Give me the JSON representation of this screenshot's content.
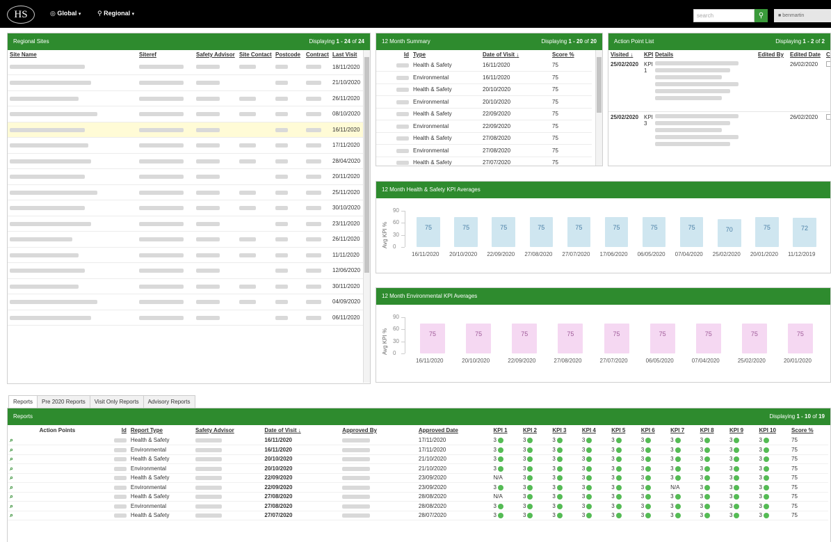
{
  "topbar": {
    "logo": "HS",
    "global_label": "Global",
    "regional_label": "Regional",
    "search_placeholder": "search",
    "user_label": "benmartin"
  },
  "regional_sites": {
    "title": "Regional Sites",
    "display_prefix": "Displaying",
    "display_range": "1 - 24",
    "display_of": "of",
    "display_total": "24",
    "columns": [
      "Site Name",
      "Siteref",
      "Safety Advisor",
      "Site Contact",
      "Postcode",
      "Contract",
      "Last Visit"
    ],
    "last_visits": [
      "18/11/2020",
      "21/10/2020",
      "26/11/2020",
      "08/10/2020",
      "16/11/2020",
      "17/11/2020",
      "28/04/2020",
      "20/11/2020",
      "25/11/2020",
      "30/10/2020",
      "23/11/2020",
      "26/11/2020",
      "11/11/2020",
      "12/06/2020",
      "30/11/2020",
      "04/09/2020",
      "06/11/2020"
    ]
  },
  "summary": {
    "title": "12 Month Summary",
    "display_prefix": "Displaying",
    "display_range": "1 - 20",
    "display_of": "of",
    "display_total": "20",
    "columns": {
      "id": "Id",
      "type": "Type",
      "date": "Date of Visit",
      "score": "Score %"
    },
    "rows": [
      {
        "type": "Health & Safety",
        "date": "16/11/2020",
        "score": "75"
      },
      {
        "type": "Environmental",
        "date": "16/11/2020",
        "score": "75"
      },
      {
        "type": "Health & Safety",
        "date": "20/10/2020",
        "score": "75"
      },
      {
        "type": "Environmental",
        "date": "20/10/2020",
        "score": "75"
      },
      {
        "type": "Health & Safety",
        "date": "22/09/2020",
        "score": "75"
      },
      {
        "type": "Environmental",
        "date": "22/09/2020",
        "score": "75"
      },
      {
        "type": "Health & Safety",
        "date": "27/08/2020",
        "score": "75"
      },
      {
        "type": "Environmental",
        "date": "27/08/2020",
        "score": "75"
      },
      {
        "type": "Health & Safety",
        "date": "27/07/2020",
        "score": "75"
      }
    ]
  },
  "action_points": {
    "title": "Action Point List",
    "display_prefix": "Displaying",
    "display_range": "1 - 2",
    "display_of": "of",
    "display_total": "2",
    "columns": {
      "visited": "Visited",
      "kpi": "KPI",
      "details": "Details",
      "edited_by": "Edited By",
      "edited_date": "Edited Date",
      "comp": "Comp"
    },
    "rows": [
      {
        "visited": "25/02/2020",
        "kpi": "KPI 1",
        "edited_date": "26/02/2020"
      },
      {
        "visited": "25/02/2020",
        "kpi": "KPI 3",
        "edited_date": "26/02/2020"
      }
    ]
  },
  "hs_chart": {
    "title": "12 Month Health & Safety KPI Averages"
  },
  "env_chart": {
    "title": "12 Month Environmental KPI Averages"
  },
  "chart_data": [
    {
      "type": "bar",
      "title": "12 Month Health & Safety KPI Averages",
      "ylabel": "Avg KPI %",
      "ylim": [
        0,
        90
      ],
      "yticks": [
        "90",
        "60",
        "30",
        "0"
      ],
      "categories": [
        "16/11/2020",
        "20/10/2020",
        "22/09/2020",
        "27/08/2020",
        "27/07/2020",
        "17/06/2020",
        "06/05/2020",
        "07/04/2020",
        "25/02/2020",
        "20/01/2020",
        "11/12/2019"
      ],
      "values": [
        75,
        75,
        75,
        75,
        75,
        75,
        75,
        75,
        70,
        75,
        72
      ],
      "color": "#cfe6f0"
    },
    {
      "type": "bar",
      "title": "12 Month Environmental KPI Averages",
      "ylabel": "Avg KPI %",
      "ylim": [
        0,
        90
      ],
      "yticks": [
        "90",
        "60",
        "30",
        "0"
      ],
      "categories": [
        "16/11/2020",
        "20/10/2020",
        "22/09/2020",
        "27/08/2020",
        "27/07/2020",
        "06/05/2020",
        "07/04/2020",
        "25/02/2020",
        "20/01/2020"
      ],
      "values": [
        75,
        75,
        75,
        75,
        75,
        75,
        75,
        75,
        75
      ],
      "color": "#f5d8f2"
    }
  ],
  "tabs": [
    "Reports",
    "Pre 2020 Reports",
    "Visit Only Reports",
    "Advisory Reports"
  ],
  "reports": {
    "title": "Reports",
    "display_prefix": "Displaying",
    "display_range": "1 - 10",
    "display_of": "of",
    "display_total": "19",
    "columns": [
      "Action Points",
      "Id",
      "Report Type",
      "Safety Advisor",
      "Date of Visit",
      "Approved By",
      "Approved Date",
      "KPI 1",
      "KPI 2",
      "KPI 3",
      "KPI 4",
      "KPI 5",
      "KPI 6",
      "KPI 7",
      "KPI 8",
      "KPI 9",
      "KPI 10",
      "Score %"
    ],
    "rows": [
      {
        "type": "Health & Safety",
        "date": "16/11/2020",
        "approved": "17/11/2020",
        "kpis": [
          "3",
          "3",
          "3",
          "3",
          "3",
          "3",
          "3",
          "3",
          "3",
          "3"
        ],
        "score": "75"
      },
      {
        "type": "Environmental",
        "date": "16/11/2020",
        "approved": "17/11/2020",
        "kpis": [
          "3",
          "3",
          "3",
          "3",
          "3",
          "3",
          "3",
          "3",
          "3",
          "3"
        ],
        "score": "75"
      },
      {
        "type": "Health & Safety",
        "date": "20/10/2020",
        "approved": "21/10/2020",
        "kpis": [
          "3",
          "3",
          "3",
          "3",
          "3",
          "3",
          "3",
          "3",
          "3",
          "3"
        ],
        "score": "75"
      },
      {
        "type": "Environmental",
        "date": "20/10/2020",
        "approved": "21/10/2020",
        "kpis": [
          "3",
          "3",
          "3",
          "3",
          "3",
          "3",
          "3",
          "3",
          "3",
          "3"
        ],
        "score": "75"
      },
      {
        "type": "Health & Safety",
        "date": "22/09/2020",
        "approved": "23/09/2020",
        "kpis": [
          "N/A",
          "3",
          "3",
          "3",
          "3",
          "3",
          "3",
          "3",
          "3",
          "3"
        ],
        "score": "75"
      },
      {
        "type": "Environmental",
        "date": "22/09/2020",
        "approved": "23/09/2020",
        "kpis": [
          "3",
          "3",
          "3",
          "3",
          "3",
          "3",
          "N/A",
          "3",
          "3",
          "3"
        ],
        "score": "75"
      },
      {
        "type": "Health & Safety",
        "date": "27/08/2020",
        "approved": "28/08/2020",
        "kpis": [
          "N/A",
          "3",
          "3",
          "3",
          "3",
          "3",
          "3",
          "3",
          "3",
          "3"
        ],
        "score": "75"
      },
      {
        "type": "Environmental",
        "date": "27/08/2020",
        "approved": "28/08/2020",
        "kpis": [
          "3",
          "3",
          "3",
          "3",
          "3",
          "3",
          "3",
          "3",
          "3",
          "3"
        ],
        "score": "75"
      },
      {
        "type": "Health & Safety",
        "date": "27/07/2020",
        "approved": "28/07/2020",
        "kpis": [
          "3",
          "3",
          "3",
          "3",
          "3",
          "3",
          "3",
          "3",
          "3",
          "3"
        ],
        "score": "75"
      }
    ]
  }
}
